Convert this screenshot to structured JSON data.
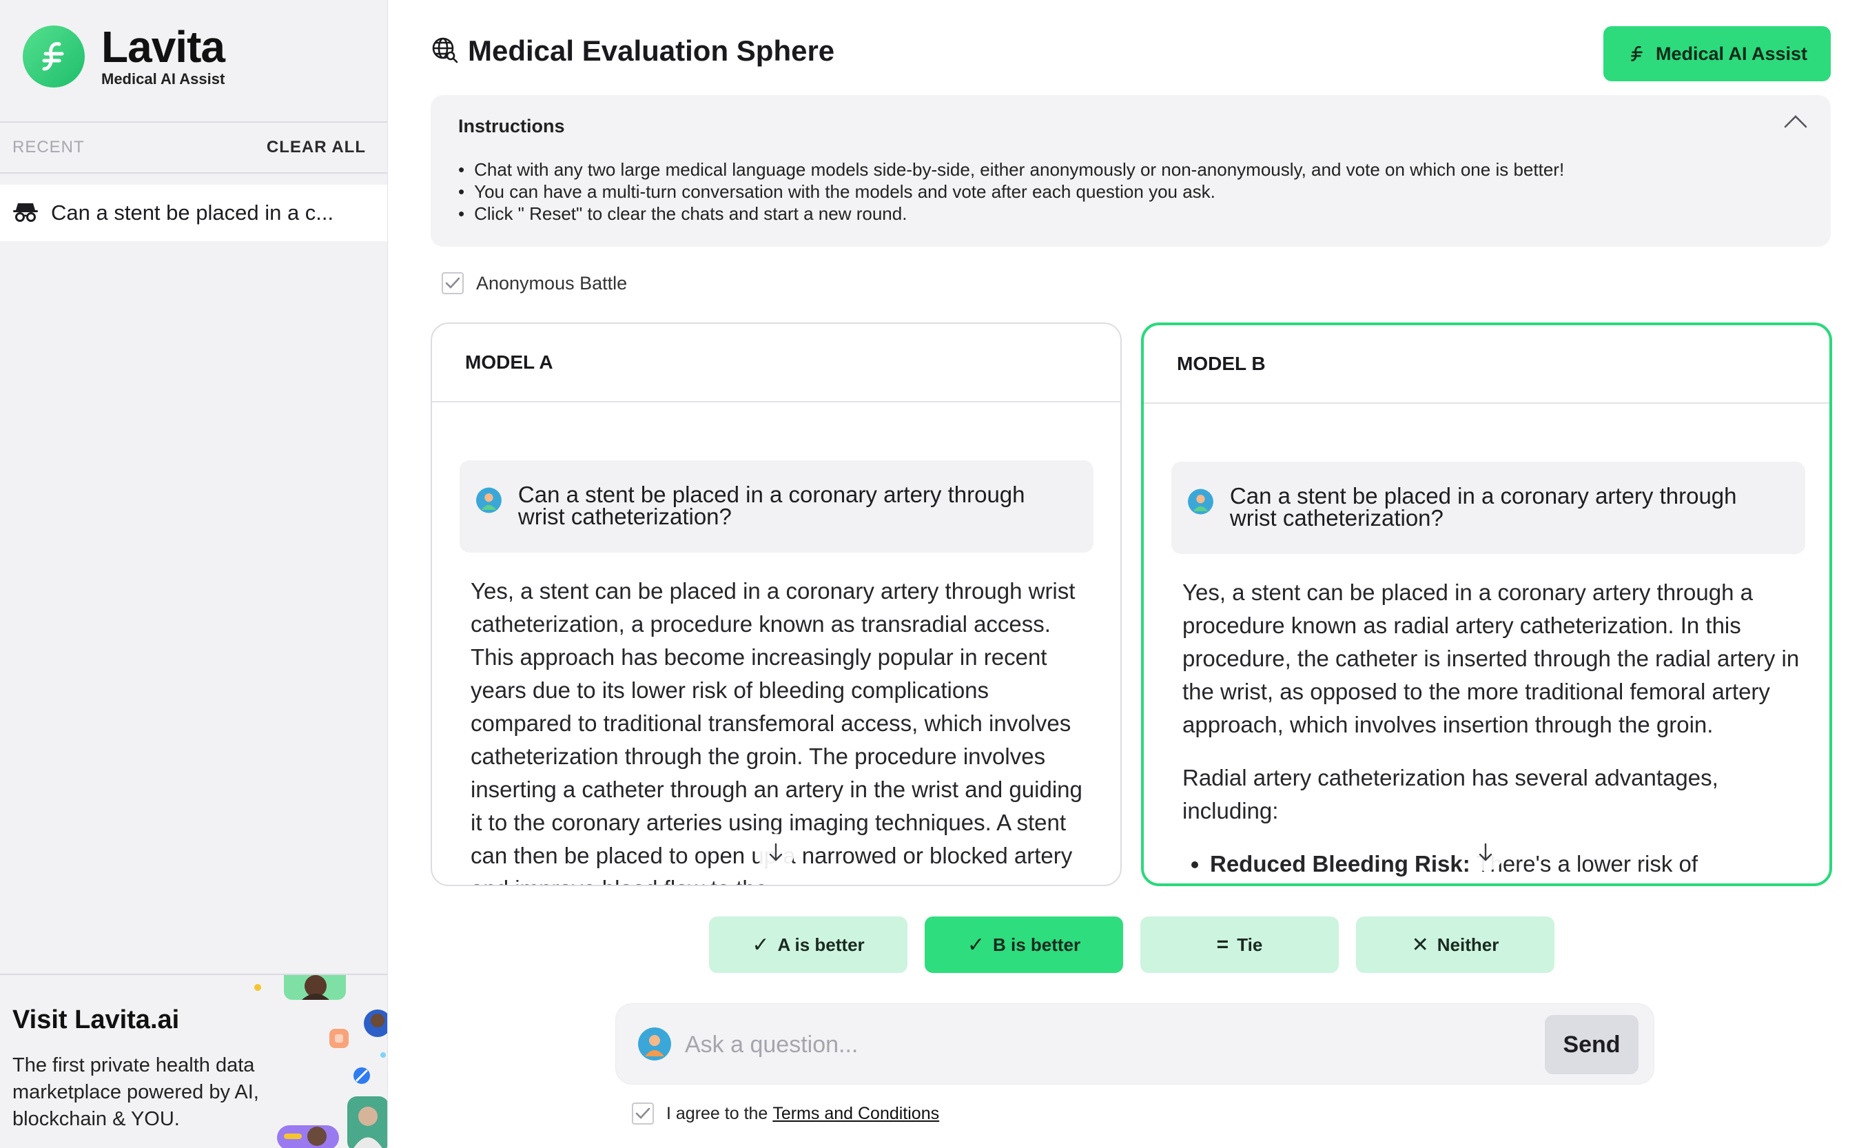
{
  "brand": {
    "name": "Lavita",
    "subtitle": "Medical AI Assist",
    "accent": "#2ddb7c"
  },
  "sidebar": {
    "recent_label": "RECENT",
    "clear_all_label": "CLEAR ALL",
    "history": [
      {
        "icon": "incognito-icon",
        "text": "Can a stent be placed in a c..."
      }
    ],
    "promo": {
      "title": "Visit Lavita.ai",
      "text": "The first private health data marketplace powered by AI, blockchain & YOU."
    }
  },
  "header": {
    "title": "Medical Evaluation Sphere",
    "title_icon": "globe-search-icon",
    "assist_button": "Medical AI Assist"
  },
  "instructions": {
    "heading": "Instructions",
    "items": [
      "Chat with any two large medical language models side-by-side, either anonymously or non-anonymously, and vote on which one is better!",
      "You can have a multi-turn conversation with the models and vote after each question you ask.",
      "Click \" Reset\" to clear the chats and start a new round."
    ]
  },
  "anonymous": {
    "label": "Anonymous Battle",
    "checked": true
  },
  "models": {
    "a": {
      "label": "MODEL A",
      "question": "Can a stent be placed in a coronary artery through wrist catheterization?",
      "answer": "Yes, a stent can be placed in a coronary artery through wrist catheterization, a procedure known as transradial access. This approach has become increasingly popular in recent years due to its lower risk of bleeding complications compared to traditional transfemoral access, which involves catheterization through the groin. The procedure involves inserting a catheter through an artery in the wrist and guiding it to the coronary arteries using imaging techniques. A stent can then be placed to open up a narrowed or blocked artery and improve blood flow to the"
    },
    "b": {
      "label": "MODEL B",
      "question": "Can a stent be placed in a coronary artery through wrist catheterization?",
      "answer_p1": "Yes, a stent can be placed in a coronary artery through a procedure known as radial artery catheterization. In this procedure, the catheter is inserted through the radial artery in the wrist, as opposed to the more traditional femoral artery approach, which involves insertion through the groin.",
      "answer_p2": "Radial artery catheterization has several advantages, including:",
      "bullet_bold": "Reduced Bleeding Risk:",
      "bullet_text": " There's a lower risk of"
    }
  },
  "votes": [
    {
      "glyph": "✓",
      "label": "A is better",
      "active": false
    },
    {
      "glyph": "✓",
      "label": "B is better",
      "active": true
    },
    {
      "glyph": "=",
      "label": "Tie",
      "active": false
    },
    {
      "glyph": "✕",
      "label": "Neither",
      "active": false
    }
  ],
  "ask": {
    "placeholder": "Ask a question...",
    "send_label": "Send"
  },
  "terms": {
    "prefix": "I agree to the",
    "link": "Terms and Conditions",
    "checked": true
  }
}
